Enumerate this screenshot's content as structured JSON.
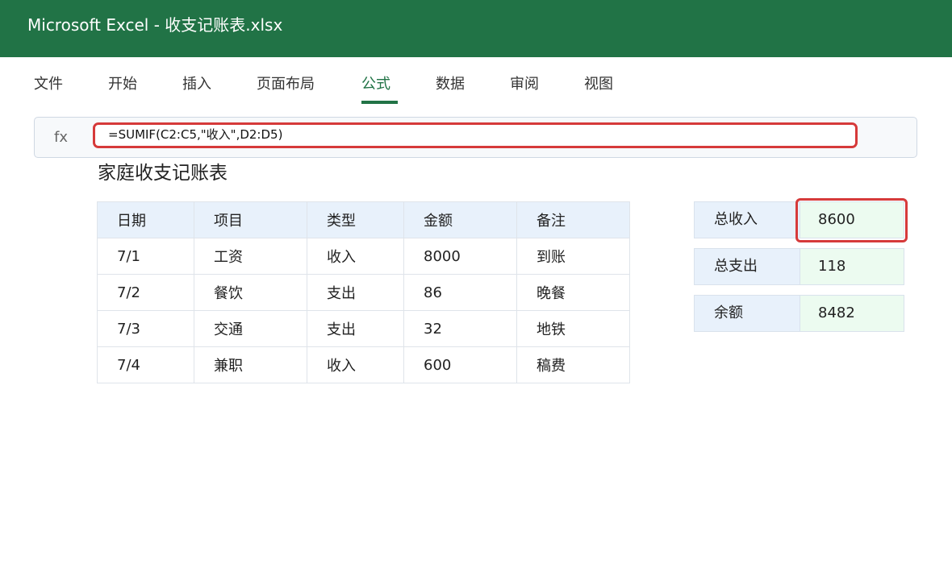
{
  "app": {
    "title": "Microsoft Excel - 收支记账表.xlsx",
    "accent_color": "#217346",
    "highlight_color": "#d63a3a"
  },
  "ribbon": {
    "tabs": [
      {
        "label": "文件",
        "active": false
      },
      {
        "label": "开始",
        "active": false
      },
      {
        "label": "插入",
        "active": false
      },
      {
        "label": "页面布局",
        "active": false
      },
      {
        "label": "公式",
        "active": true
      },
      {
        "label": "数据",
        "active": false
      },
      {
        "label": "审阅",
        "active": false
      },
      {
        "label": "视图",
        "active": false
      }
    ]
  },
  "formula_bar": {
    "fx_label": "fx",
    "formula": "=SUMIF(C2:C5,\"收入\",D2:D5)"
  },
  "sheet": {
    "title": "家庭收支记账表",
    "columns": [
      "日期",
      "项目",
      "类型",
      "金额",
      "备注"
    ],
    "rows": [
      [
        "7/1",
        "工资",
        "收入",
        "8000",
        "到账"
      ],
      [
        "7/2",
        "餐饮",
        "支出",
        "86",
        "晚餐"
      ],
      [
        "7/3",
        "交通",
        "支出",
        "32",
        "地铁"
      ],
      [
        "7/4",
        "兼职",
        "收入",
        "600",
        "稿费"
      ]
    ]
  },
  "summary": [
    {
      "label": "总收入",
      "value": "8600",
      "highlighted": true
    },
    {
      "label": "总支出",
      "value": "118",
      "highlighted": false
    },
    {
      "label": "余额",
      "value": "8482",
      "highlighted": false
    }
  ]
}
